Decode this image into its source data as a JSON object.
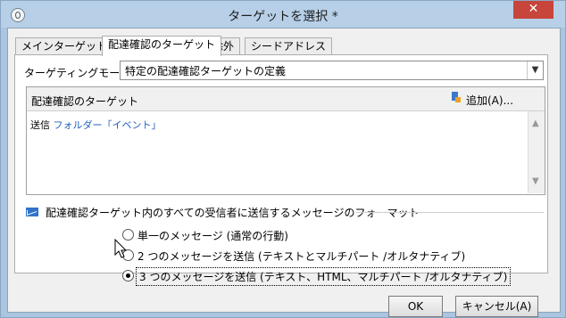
{
  "window": {
    "title": "ターゲットを選択 *",
    "close_label": "✕"
  },
  "tabs": [
    {
      "label": "メインターゲット"
    },
    {
      "label": "配達確認のターゲット"
    },
    {
      "label": "除外"
    },
    {
      "label": "シードアドレス"
    }
  ],
  "targeting": {
    "mode_label": "ターゲティングモード:",
    "mode_value": "特定の配達確認ターゲットの定義"
  },
  "proof_targets": {
    "header": "配達確認のターゲット",
    "add_label": "追加(A)...",
    "row_prefix": "送信",
    "row_link": "フォルダー「イベント」"
  },
  "format": {
    "title": "配達確認ターゲット内のすべての受信者に送信するメッセージのフォーマット",
    "options": [
      {
        "label": "単一のメッセージ (通常の行動)",
        "selected": false
      },
      {
        "label": "2 つのメッセージを送信 (テキストとマルチパート /オルタナティブ)",
        "selected": false
      },
      {
        "label": "3 つのメッセージを送信 (テキスト、HTML、マルチパート /オルタナティブ)",
        "selected": true
      }
    ]
  },
  "buttons": {
    "ok": "OK",
    "cancel": "キャンセル(A)"
  }
}
